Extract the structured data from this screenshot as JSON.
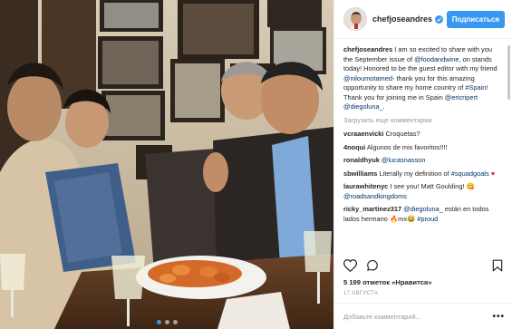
{
  "post": {
    "username": "chefjoseandres",
    "verified": true,
    "follow_label": "Подписаться",
    "caption": {
      "t1": "I am so excited to share with you the September issue of ",
      "m1": "@foodandwine",
      "t2": ", on stands today! Honored to be the guest editor with my friend ",
      "m2": "@niloumotamed",
      "t3": "- thank you for this amazing opportunity to share my home country of ",
      "m3": "#Spain",
      "t4": "! Thank you for joining me in Spain ",
      "m4": "@ericripert",
      "t5": " ",
      "m5": "@diegoluna_",
      "t6": "."
    },
    "load_more": "Загрузить еще комментарии",
    "comments": [
      {
        "user": "vcraaenvicki",
        "text": " Croquetas?"
      },
      {
        "user": "4noqui",
        "text": " Algunos de mis favoritos!!!!"
      },
      {
        "user": "ronaldhyuk",
        "text": " ",
        "mention": "@lucasnasson"
      },
      {
        "user": "sbwilliams",
        "text": " Literally my definition of ",
        "mention": "#squadgoals",
        "emoji": "♥"
      },
      {
        "user": "laurawhitenyc",
        "text": " I see you! Matt Goulding! ",
        "emoji": "😋",
        "mention": "@roadsandkingdoms"
      },
      {
        "user": "ricky_martinez317",
        "mention": "@diegoluna_",
        "text": " están en todos lados hermano ",
        "emoji": "🔥",
        "tail": "mx",
        "emoji2": "😂",
        "hash": "#proud"
      }
    ],
    "likes": "5 199 отметок «Нравится»",
    "date": "17 АВГУСТА",
    "add_comment_placeholder": "Добавьте комментарий...",
    "more_icon": "more-horizontal-icon",
    "accent_color": "#3897f0"
  },
  "carousel": {
    "slides": 3,
    "active": 1
  }
}
